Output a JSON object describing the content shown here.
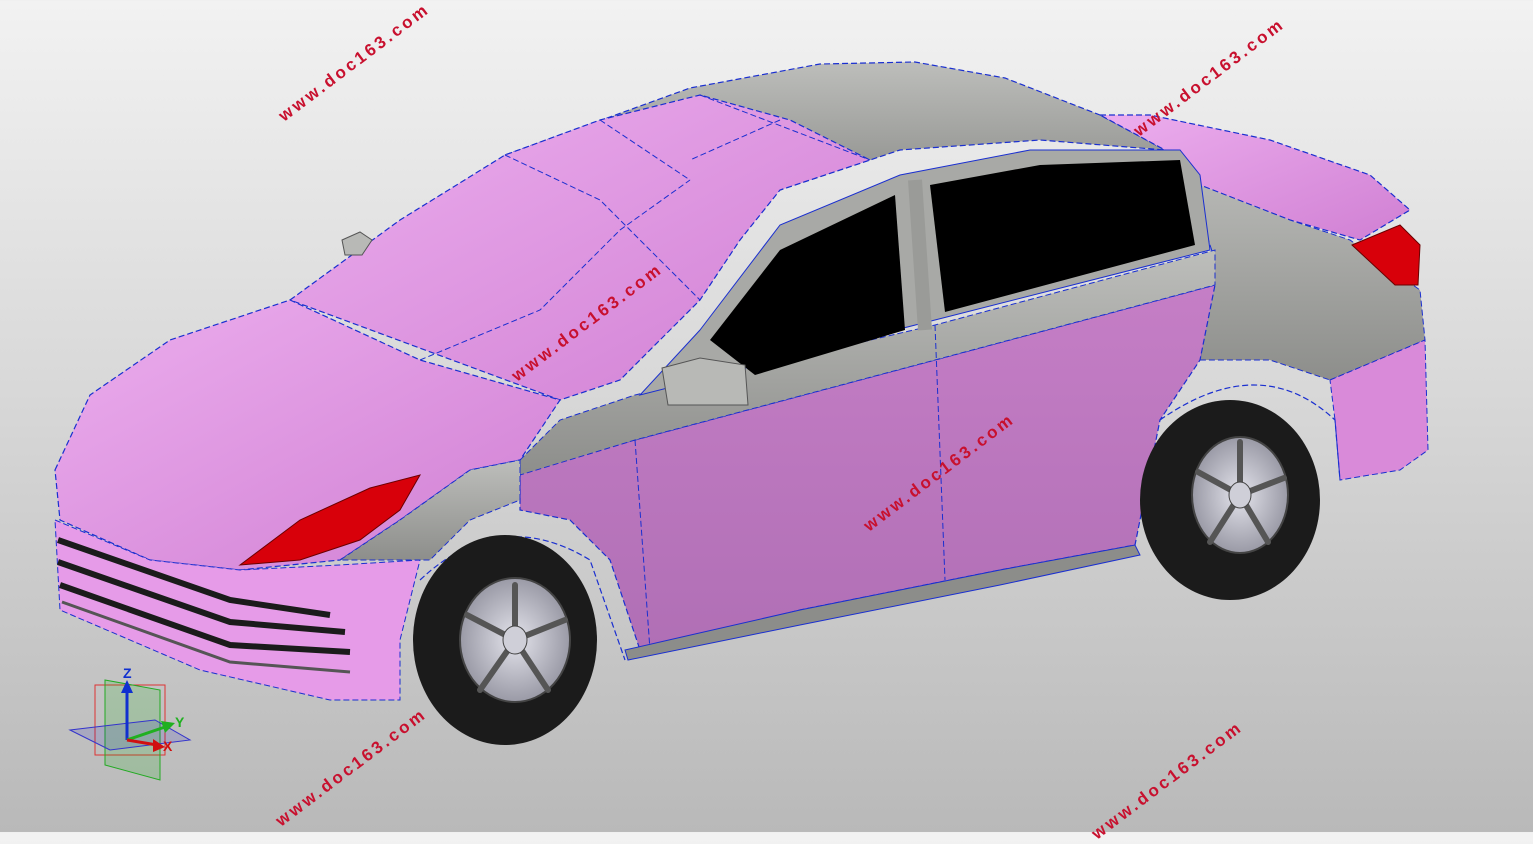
{
  "viewport": {
    "background": [
      "#f2f2f2",
      "#b9b9b9"
    ]
  },
  "colors": {
    "body_pink": "#d985d9",
    "body_pink_light": "#e9a7ea",
    "panel_gray": "#a9aaa8",
    "glass": "#000000",
    "light_red": "#d8000a",
    "edge_blue": "#1a2fd0",
    "tire": "#1b1b1b",
    "rim": "#b9b9c4"
  },
  "watermarks": [
    "www.doc163.com",
    "www.doc163.com",
    "www.doc163.com",
    "www.doc163.com",
    "www.doc163.com",
    "www.doc163.com"
  ],
  "triad": {
    "z_label": "Z",
    "y_label": "Y",
    "x_label": "X"
  }
}
